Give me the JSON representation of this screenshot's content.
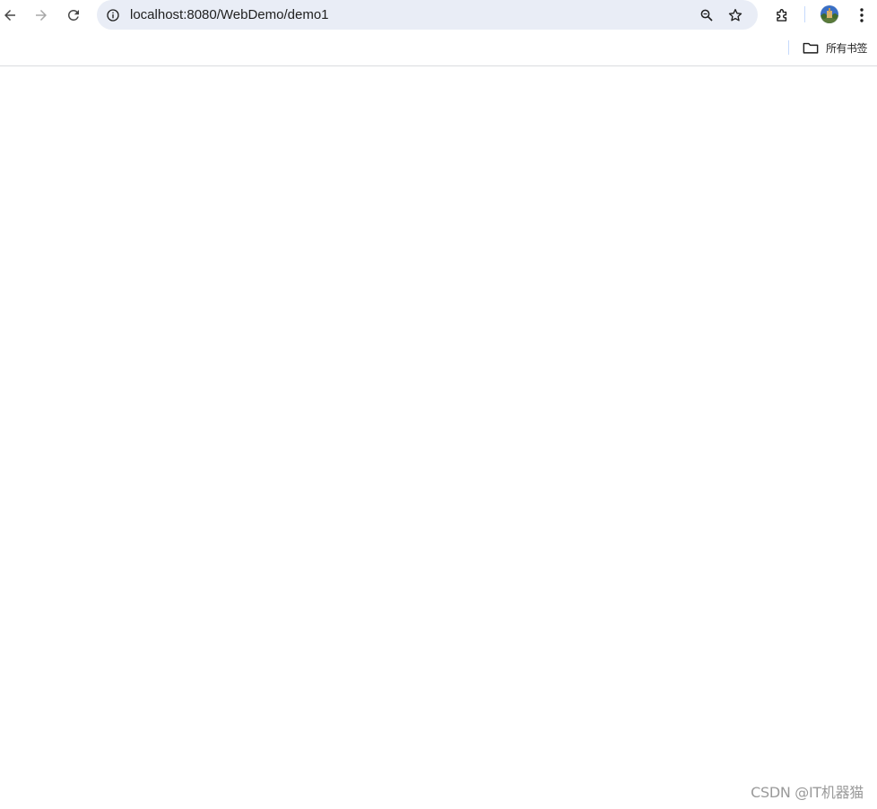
{
  "toolbar": {
    "back_icon": "arrow-back-icon",
    "forward_icon": "arrow-forward-icon",
    "reload_icon": "reload-icon",
    "url": "localhost:8080/WebDemo/demo1",
    "site_info_icon": "info-icon",
    "zoom_icon": "zoom-icon",
    "bookmark_star_icon": "star-icon",
    "extensions_icon": "puzzle-icon",
    "menu_icon": "kebab-menu-icon"
  },
  "bookmarks_bar": {
    "all_bookmarks_label": "所有书签",
    "folder_icon": "folder-icon"
  },
  "page": {
    "watermark": "CSDN @IT机器猫"
  },
  "colors": {
    "omnibox_bg": "#e9edf6",
    "divider": "#c6dafc",
    "watermark": "#9a9a9a"
  }
}
